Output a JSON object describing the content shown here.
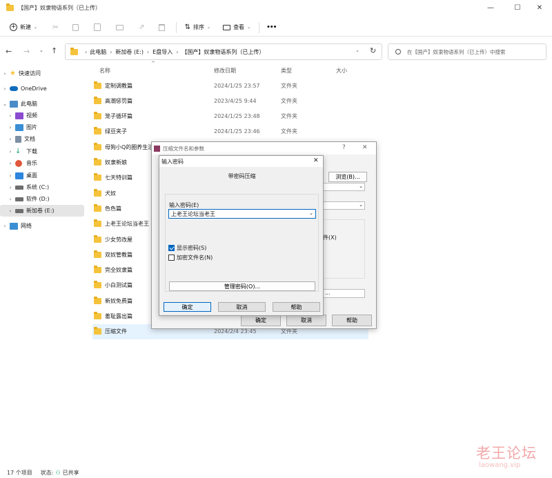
{
  "window": {
    "title": "【国产】奴隶物语系列（已上传）",
    "minimize": "—",
    "maximize": "☐",
    "close": "✕"
  },
  "toolbar": {
    "new_label": "新建",
    "sort_label": "排序",
    "view_label": "查看",
    "more": "•••"
  },
  "address": {
    "segments": [
      "此电脑",
      "新加卷 (E:)",
      "E盘导入",
      "【国产】奴隶物语系列（已上传）"
    ],
    "search_placeholder": "在【国产】奴隶物语系列（已上传）中搜索"
  },
  "sidebar": {
    "items": [
      {
        "label": "快速访问",
        "icon": "star-icon",
        "color": "#f5c33b"
      },
      {
        "label": "OneDrive",
        "icon": "cloud-icon",
        "color": "#0f6cbd"
      },
      {
        "label": "此电脑",
        "icon": "computer-icon",
        "color": "#4a8cc7"
      },
      {
        "label": "视频",
        "icon": "video-icon",
        "color": "#8a4bd1"
      },
      {
        "label": "图片",
        "icon": "picture-icon",
        "color": "#3a8fd4"
      },
      {
        "label": "文档",
        "icon": "document-icon",
        "color": "#7d8fa3"
      },
      {
        "label": "下载",
        "icon": "download-icon",
        "color": "#16a06a"
      },
      {
        "label": "音乐",
        "icon": "music-icon",
        "color": "#e0563b"
      },
      {
        "label": "桌面",
        "icon": "desktop-icon",
        "color": "#2e86de"
      },
      {
        "label": "系统 (C:)",
        "icon": "drive-icon",
        "color": "#6d6d6d"
      },
      {
        "label": "软件 (D:)",
        "icon": "drive-icon",
        "color": "#6d6d6d"
      },
      {
        "label": "新加卷 (E:)",
        "icon": "drive-icon",
        "color": "#6d6d6d"
      },
      {
        "label": "网络",
        "icon": "network-icon",
        "color": "#3a8fd4"
      }
    ]
  },
  "columns": {
    "name": "名称",
    "date": "修改日期",
    "type": "类型",
    "size": "大小"
  },
  "files": [
    {
      "name": "定制调教篇",
      "date": "2024/1/25 23:57",
      "type": "文件夹"
    },
    {
      "name": "高潮惩罚篇",
      "date": "2023/4/25 9:44",
      "type": "文件夹"
    },
    {
      "name": "笼子循环篇",
      "date": "2024/1/25 23:48",
      "type": "文件夹"
    },
    {
      "name": "绿豆夹子",
      "date": "2024/1/25 23:46",
      "type": "文件夹"
    },
    {
      "name": "母狗小Q的圈养生活",
      "date": "",
      "type": ""
    },
    {
      "name": "奴隶新娘",
      "date": "",
      "type": ""
    },
    {
      "name": "七天特训篇",
      "date": "",
      "type": ""
    },
    {
      "name": "犬奴",
      "date": "",
      "type": ""
    },
    {
      "name": "色色篇",
      "date": "",
      "type": ""
    },
    {
      "name": "上老王论坛当老王",
      "date": "",
      "type": ""
    },
    {
      "name": "少女劳改屋",
      "date": "",
      "type": ""
    },
    {
      "name": "双奴管教篇",
      "date": "",
      "type": ""
    },
    {
      "name": "完全奴隶篇",
      "date": "",
      "type": ""
    },
    {
      "name": "小白测试篇",
      "date": "",
      "type": ""
    },
    {
      "name": "新奴免费篇",
      "date": "",
      "type": ""
    },
    {
      "name": "羞耻露出篇",
      "date": "",
      "type": ""
    },
    {
      "name": "压缩文件",
      "date": "2024/2/4 23:45",
      "type": "文件夹"
    }
  ],
  "statusbar": {
    "count": "17 个项目",
    "state": "状态:",
    "shared": "已共享"
  },
  "archive_dialog": {
    "title": "压缩文件名和参数",
    "help": "?",
    "close": "✕",
    "browse": "浏览(B)...",
    "file_label": "件(X)",
    "ok": "确定",
    "cancel": "取消",
    "help_btn": "帮助",
    "dots": "..."
  },
  "password_dialog": {
    "title": "输入密码",
    "close": "✕",
    "heading": "带密码压缩",
    "field_label": "输入密码(E)",
    "value": "上老王论坛当老王",
    "show_password": "显示密码(S)",
    "encrypt_names": "加密文件名(N)",
    "manage": "管理密码(O)...",
    "ok": "确定",
    "cancel": "取消",
    "help": "帮助"
  },
  "watermark": {
    "text": "老王论坛",
    "sub": "laowang.vip"
  }
}
